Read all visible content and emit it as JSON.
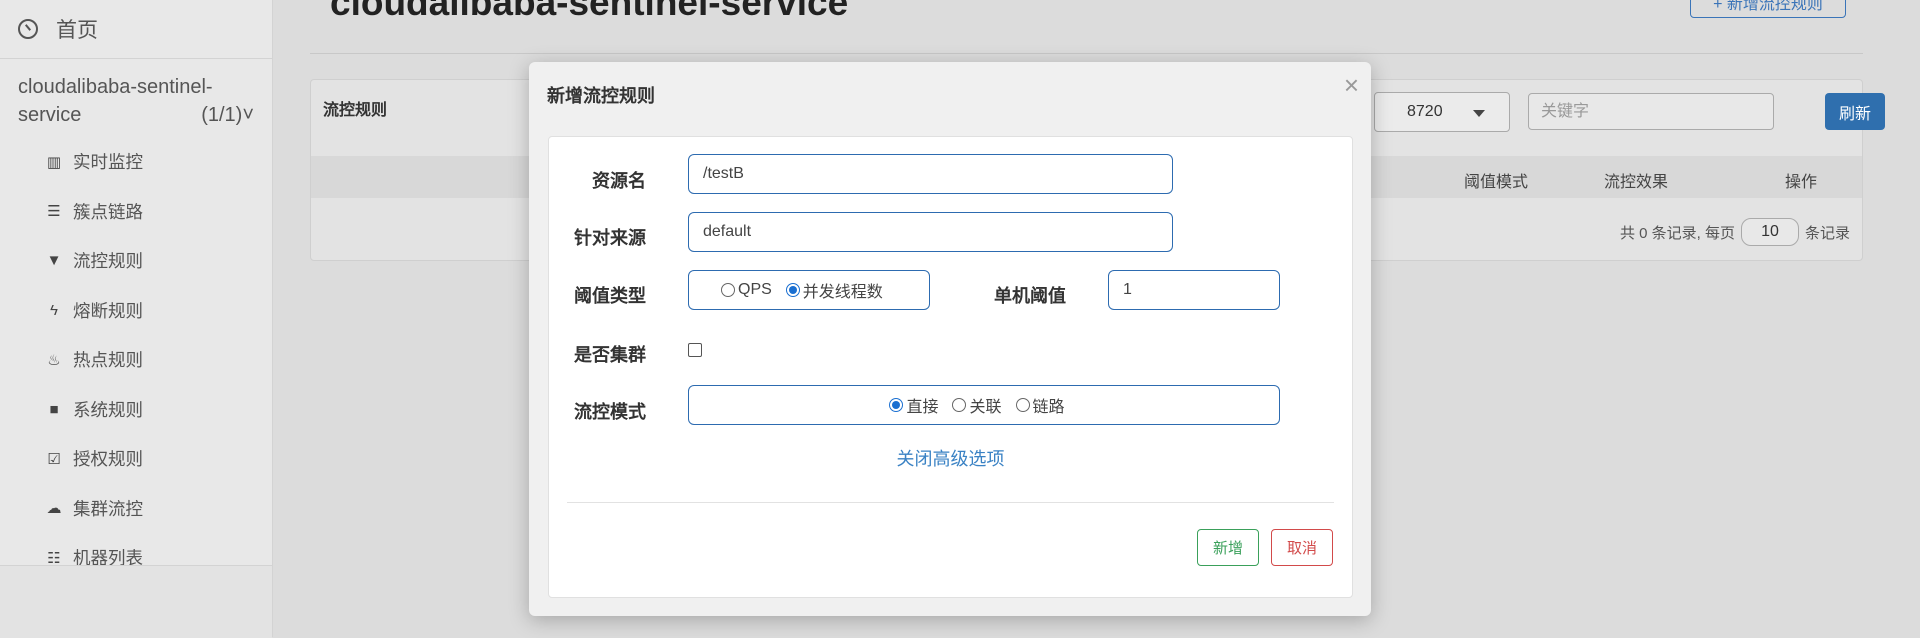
{
  "sidebar": {
    "home_label": "首页",
    "app_name": "cloudalibaba-sentinel-service",
    "app_count": "(1/1)",
    "items": [
      {
        "label": "实时监控",
        "icon": "bar-chart-icon"
      },
      {
        "label": "簇点链路",
        "icon": "list-icon"
      },
      {
        "label": "流控规则",
        "icon": "filter-icon"
      },
      {
        "label": "熔断规则",
        "icon": "flash-icon"
      },
      {
        "label": "热点规则",
        "icon": "fire-icon"
      },
      {
        "label": "系统规则",
        "icon": "lock-icon"
      },
      {
        "label": "授权规则",
        "icon": "check-square-icon"
      },
      {
        "label": "集群流控",
        "icon": "cloud-icon"
      },
      {
        "label": "机器列表",
        "icon": "th-list-icon"
      }
    ]
  },
  "main": {
    "title": "cloudalibaba-sentinel-service",
    "new_rule_button": "+ 新增流控规则",
    "panel_title": "流控规则",
    "machine_select": "8720",
    "keyword_placeholder": "关键字",
    "refresh_label": "刷新",
    "columns": [
      "阈值模式",
      "流控效果",
      "操作"
    ],
    "pager": {
      "prefix": "共 0 条记录, 每页",
      "page_size": "10",
      "suffix": "条记录"
    }
  },
  "modal": {
    "title": "新增流控规则",
    "close_symbol": "×",
    "resource_label": "资源名",
    "resource_value": "/testB",
    "source_label": "针对来源",
    "source_value": "default",
    "threshold_type_label": "阈值类型",
    "threshold_type_options": [
      "QPS",
      "并发线程数"
    ],
    "threshold_type_selected": "并发线程数",
    "single_threshold_label": "单机阈值",
    "single_threshold_value": "1",
    "cluster_label": "是否集群",
    "cluster_checked": false,
    "mode_label": "流控模式",
    "mode_options": [
      "直接",
      "关联",
      "链路"
    ],
    "mode_selected": "直接",
    "advanced_toggle": "关闭高级选项",
    "add_button": "新增",
    "cancel_button": "取消"
  },
  "colors": {
    "primary": "#2f6fae",
    "link": "#3a82c4",
    "success": "#3aa05a",
    "danger": "#d24a4a"
  }
}
